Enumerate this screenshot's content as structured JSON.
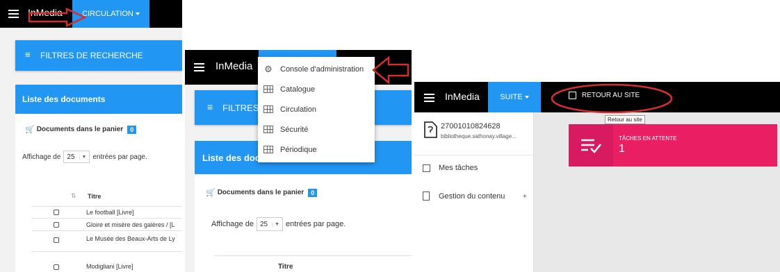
{
  "panel1": {
    "brand": "InMedia",
    "nav_tab": "CIRCULATION",
    "filters_label": "FILTRES DE RECHERCHE",
    "list_title": "Liste des documents",
    "cart_label": "Documents dans le panier",
    "cart_count": "0",
    "show_prefix": "Affichage de",
    "show_value": "25",
    "show_suffix": "entrées par page.",
    "table_header": "Titre",
    "rows": [
      "Le football [Livre]",
      "Gloire et misère des galères / [L",
      "Le Musée des Beaux-Arts de Ly",
      "Modigliani [Livre]"
    ]
  },
  "panel2": {
    "brand": "InMedia",
    "filters_label": "FILTRES",
    "list_title": "Liste des doc",
    "cart_label": "Documents dans le panier",
    "cart_count": "0",
    "show_prefix": "Affichage de",
    "show_value": "25",
    "show_suffix": "entrées par page.",
    "table_header": "Titre",
    "menu": [
      {
        "label": "Console d'administration",
        "icon": "gear-icon"
      },
      {
        "label": "Catalogue",
        "icon": "grid-icon"
      },
      {
        "label": "Circulation",
        "icon": "grid-icon"
      },
      {
        "label": "Sécurité",
        "icon": "grid-icon"
      },
      {
        "label": "Périodique",
        "icon": "grid-icon"
      }
    ]
  },
  "panel3": {
    "brand": "InMedia",
    "nav_tab": "SUITE",
    "back_link": "RETOUR AU SITE",
    "tooltip": "Retour au site",
    "user_id": "27001010824628",
    "user_site": "bibliotheque.sathonay.village...",
    "side_items": [
      "Mes tâches",
      "Gestion du contenu"
    ],
    "side_plus": "+",
    "tile_title": "TÂCHES EN ATTENTE",
    "tile_value": "1"
  },
  "colors": {
    "primary": "#2196f3",
    "topbar": "#000000",
    "tile": "#e91e63",
    "annotation": "#d32f2f"
  }
}
